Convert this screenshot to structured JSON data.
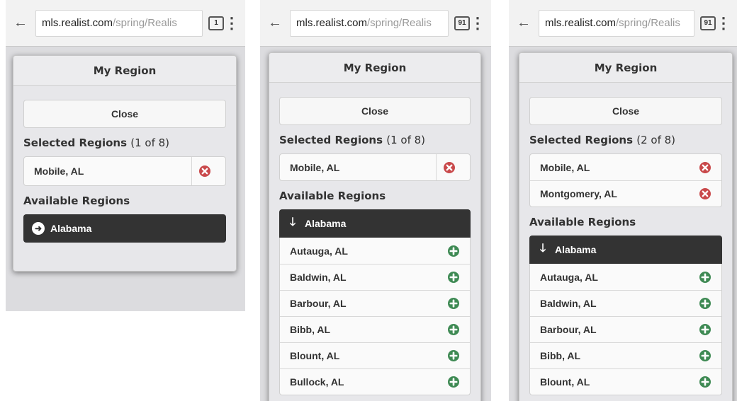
{
  "browser": {
    "url_host": "mls.realist.com",
    "url_rest": "/spring/Realis",
    "tab_count_1": "1",
    "tab_count_2": "91",
    "tab_count_3": "91"
  },
  "modal": {
    "title": "My Region",
    "close_label": "Close",
    "selected_label": "Selected Regions",
    "available_label": "Available Regions"
  },
  "panel1": {
    "count": "(1 of 8)",
    "selected": [
      "Mobile, AL"
    ],
    "state": "Alabama"
  },
  "panel2": {
    "count": "(1 of 8)",
    "selected": [
      "Mobile, AL"
    ],
    "state": "Alabama",
    "available": [
      "Autauga, AL",
      "Baldwin, AL",
      "Barbour, AL",
      "Bibb, AL",
      "Blount, AL",
      "Bullock, AL"
    ]
  },
  "panel3": {
    "count": "(2 of 8)",
    "selected": [
      "Mobile, AL",
      "Montgomery, AL"
    ],
    "state": "Alabama",
    "available": [
      "Autauga, AL",
      "Baldwin, AL",
      "Barbour, AL",
      "Bibb, AL",
      "Blount, AL"
    ]
  },
  "colors": {
    "remove_icon": "#c9494b",
    "add_icon": "#3f8a54",
    "state_header": "#333333"
  }
}
